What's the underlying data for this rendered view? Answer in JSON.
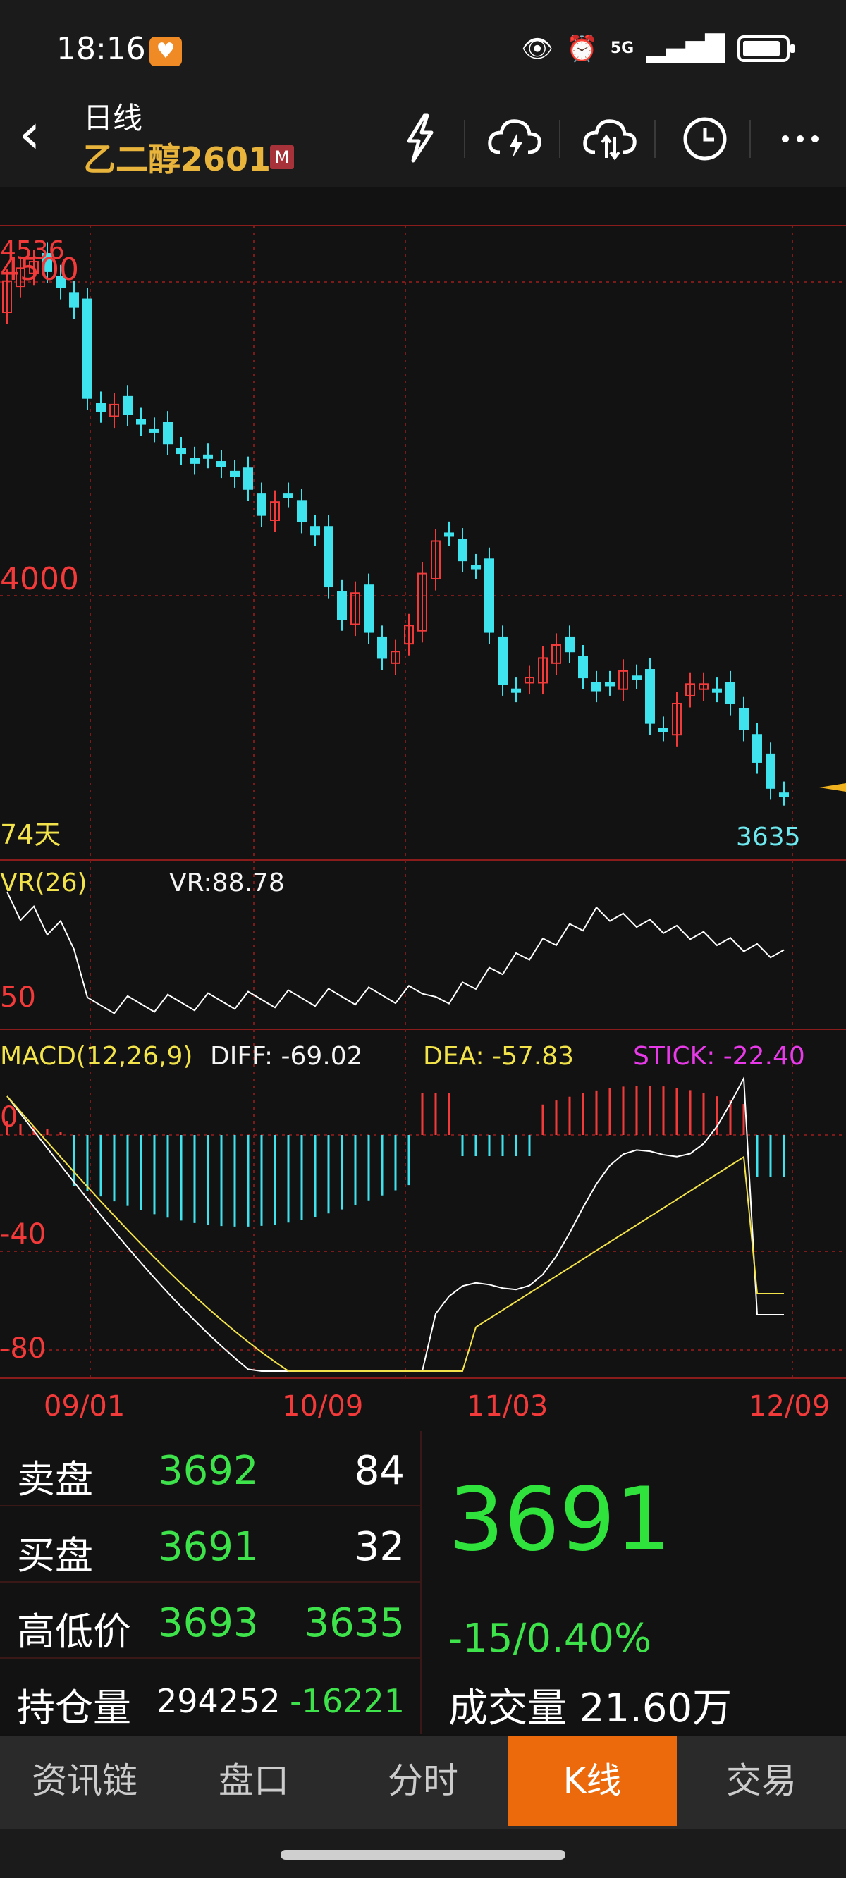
{
  "status_bar": {
    "time": "18:16",
    "network": "5G",
    "icons": [
      "heart-app-icon",
      "eye-icon",
      "alarm-icon",
      "signal-icon",
      "battery-icon"
    ]
  },
  "header": {
    "period": "日线",
    "contract": "乙二醇2601",
    "badge": "M",
    "tools": [
      "flash-icon",
      "cloud-download-icon",
      "cloud-sync-icon",
      "clock-icon",
      "more-icon"
    ]
  },
  "price_panel": {
    "top_label": "4536",
    "level_4500": "4500",
    "level_4000": "4000",
    "days_label": "74天",
    "low_marker": "3635"
  },
  "vr_panel": {
    "name": "VR(26)",
    "value": "VR:88.78",
    "level_label": "50"
  },
  "macd_panel": {
    "name": "MACD(12,26,9)",
    "diff": "DIFF: -69.02",
    "dea": "DEA: -57.83",
    "stick": "STICK: -22.40",
    "level_0": "0",
    "level_m40": "-40",
    "level_m80": "-80"
  },
  "x_axis": [
    "09/01",
    "10/09",
    "11/03",
    "12/09"
  ],
  "colors": {
    "up": "#f23a3a",
    "down": "#3fe3ee",
    "diff_line": "#ffffff",
    "dea_line": "#f3e34a",
    "grid": "#7a1a1a",
    "accent_tab": "#ec6a0c"
  },
  "chart_data": {
    "type": "candlestick",
    "title": "乙二醇2601 日线",
    "dates_labeled": [
      "09/01",
      "10/09",
      "11/03",
      "12/09"
    ],
    "price_ylim": [
      3635,
      4536
    ],
    "closes_approx": [
      4480,
      4500,
      4510,
      4495,
      4470,
      4440,
      4300,
      4280,
      4290,
      4275,
      4260,
      4250,
      4230,
      4215,
      4200,
      4210,
      4195,
      4180,
      4160,
      4120,
      4140,
      4150,
      4110,
      4090,
      4010,
      3960,
      4000,
      3940,
      3900,
      3910,
      3950,
      4030,
      4080,
      4090,
      4050,
      4040,
      3940,
      3860,
      3850,
      3870,
      3900,
      3920,
      3910,
      3870,
      3850,
      3860,
      3880,
      3870,
      3800,
      3790,
      3830,
      3860,
      3860,
      3850,
      3830,
      3790,
      3740,
      3700,
      3691
    ],
    "vr": {
      "last": 88.78
    },
    "macd": {
      "diff": -69.02,
      "dea": -57.83,
      "stick": -22.4
    }
  },
  "quote": {
    "ask_label": "卖盘",
    "ask_price": "3692",
    "ask_vol": "84",
    "bid_label": "买盘",
    "bid_price": "3691",
    "bid_vol": "32",
    "hl_label": "高低价",
    "high": "3693",
    "low": "3635",
    "oi_label": "持仓量",
    "oi": "294252",
    "oi_change": "-16221",
    "last_price": "3691",
    "change": "-15/0.40%",
    "volume_label": "成交量",
    "volume": "21.60万"
  },
  "tabs": [
    {
      "label": "资讯链"
    },
    {
      "label": "盘口"
    },
    {
      "label": "分时"
    },
    {
      "label": "K线",
      "active": true
    },
    {
      "label": "交易"
    }
  ]
}
